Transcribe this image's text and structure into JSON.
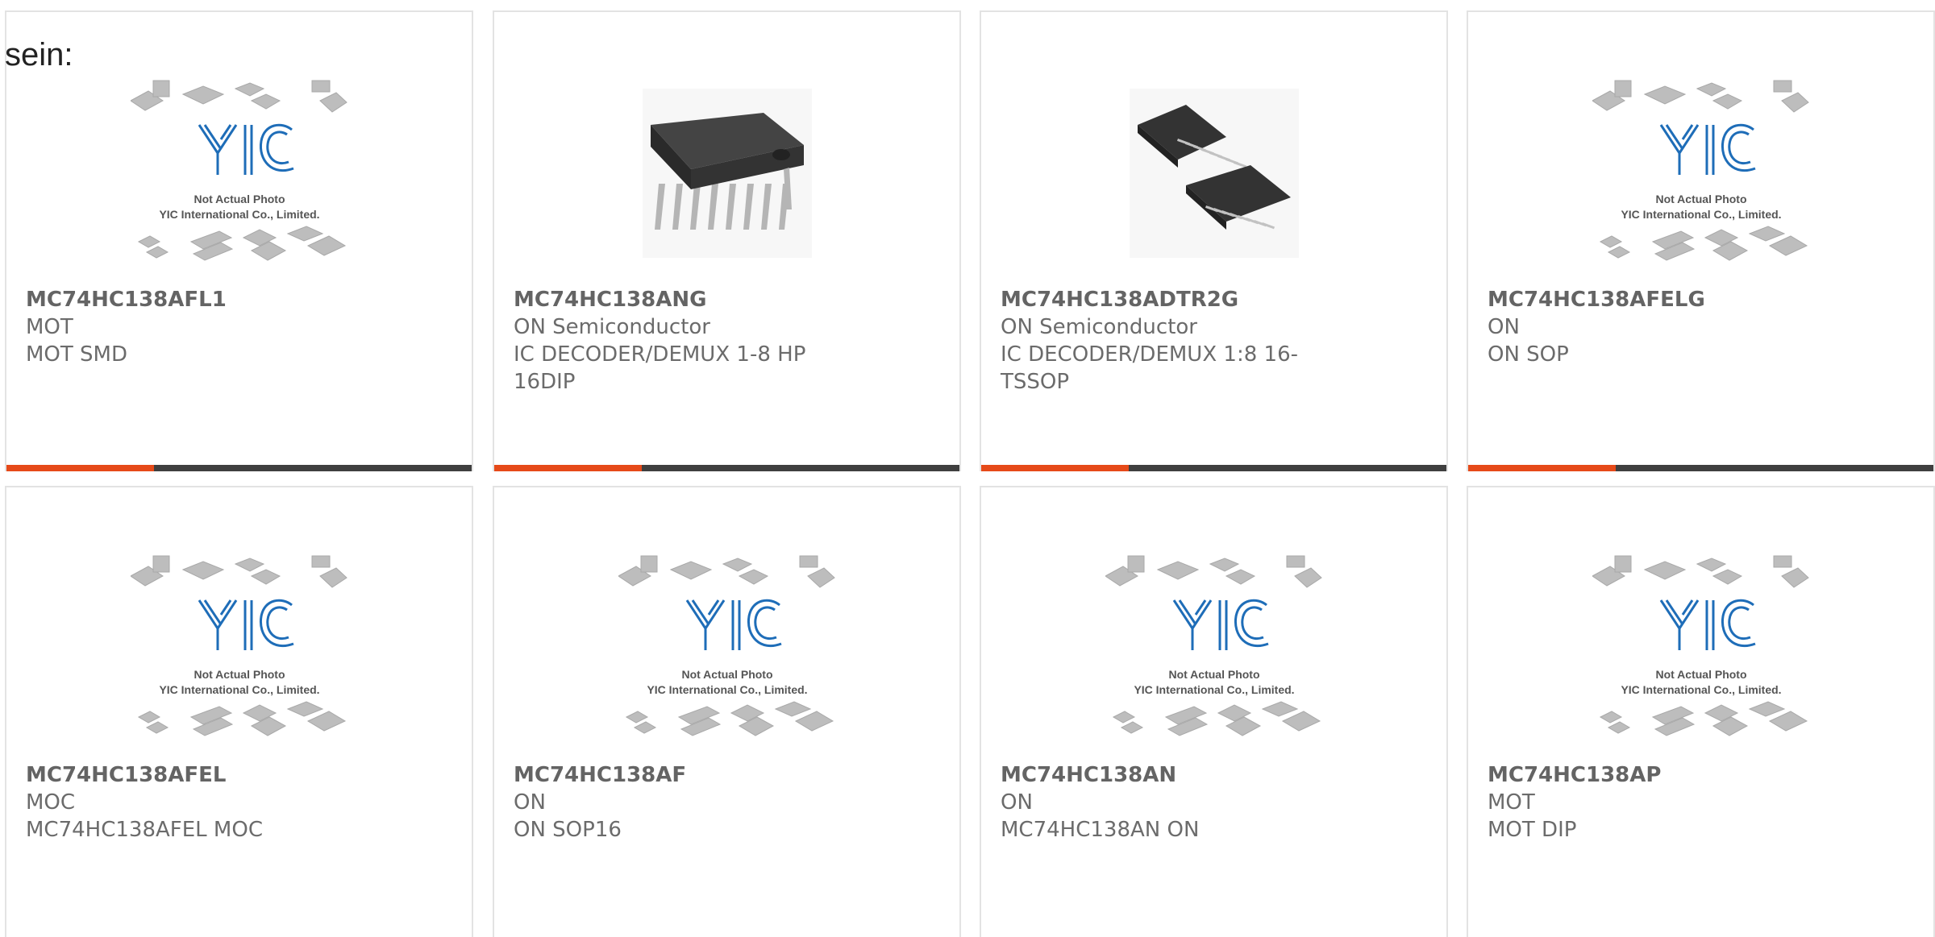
{
  "page": {
    "partial_heading": "sein:"
  },
  "placeholder": {
    "line1": "Not Actual Photo",
    "line2": "YIC International Co., Limited."
  },
  "products": [
    {
      "part_number": "MC74HC138AFL1",
      "manufacturer": "MOT",
      "description": "MOT SMD",
      "image": "placeholder",
      "accent_bar": true
    },
    {
      "part_number": "MC74HC138ANG",
      "manufacturer": "ON Semiconductor",
      "description": "IC DECODER/DEMUX 1-8 HP 16DIP",
      "image": "dip16-chip-photo",
      "accent_bar": true
    },
    {
      "part_number": "MC74HC138ADTR2G",
      "manufacturer": "ON Semiconductor",
      "description": "IC DECODER/DEMUX 1:8 16-TSSOP",
      "image": "tssop16-chip-photo",
      "accent_bar": true
    },
    {
      "part_number": "MC74HC138AFELG",
      "manufacturer": "ON",
      "description": "ON SOP",
      "image": "placeholder",
      "accent_bar": true
    },
    {
      "part_number": "MC74HC138AFEL",
      "manufacturer": "MOC",
      "description": "MC74HC138AFEL MOC",
      "image": "placeholder",
      "accent_bar": false
    },
    {
      "part_number": "MC74HC138AF",
      "manufacturer": "ON",
      "description": "ON SOP16",
      "image": "placeholder",
      "accent_bar": false
    },
    {
      "part_number": "MC74HC138AN",
      "manufacturer": "ON",
      "description": "MC74HC138AN ON",
      "image": "placeholder",
      "accent_bar": false
    },
    {
      "part_number": "MC74HC138AP",
      "manufacturer": "MOT",
      "description": "MOT DIP",
      "image": "placeholder",
      "accent_bar": false
    }
  ],
  "colors": {
    "accent": "#e64a19",
    "bar": "#3f3f3f",
    "logo_blue": "#1e6db8",
    "text": "#6b6b6b",
    "border": "#e3e3e3"
  }
}
